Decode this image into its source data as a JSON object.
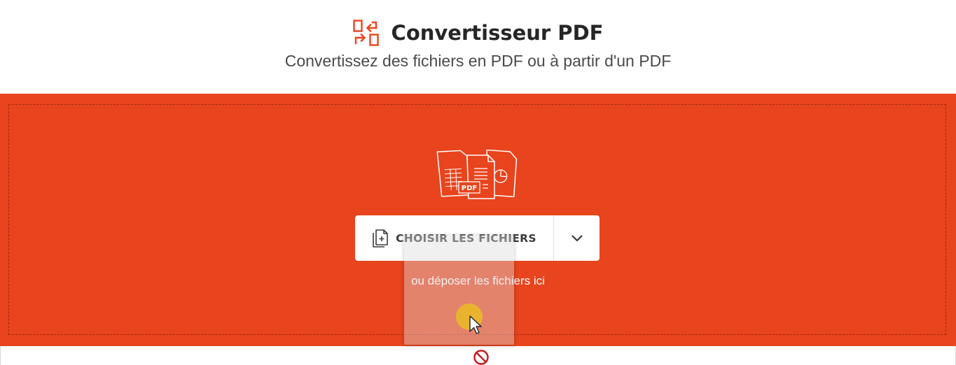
{
  "header": {
    "title": "Convertisseur PDF",
    "subtitle": "Convertissez des fichiers en PDF ou à partir d'un PDF",
    "icon": "convert-arrows-icon"
  },
  "dropzone": {
    "illustration_badge": "PDF",
    "choose_button_label": "CHOISIR LES FICHIERS",
    "choose_button_icon": "add-file-icon",
    "dropdown_icon": "chevron-down-icon",
    "drop_hint": "ou déposer les fichiers ici",
    "background_color": "#e8441d"
  },
  "overlay": {
    "drag_ghost": "dragged-file-ghost",
    "cursor_icon": "arrow-cursor-icon",
    "drop_state_icon": "no-drop-icon"
  },
  "colors": {
    "accent": "#e8441d",
    "click_highlight": "#e9b52d",
    "no_drop": "#c41b1b"
  }
}
